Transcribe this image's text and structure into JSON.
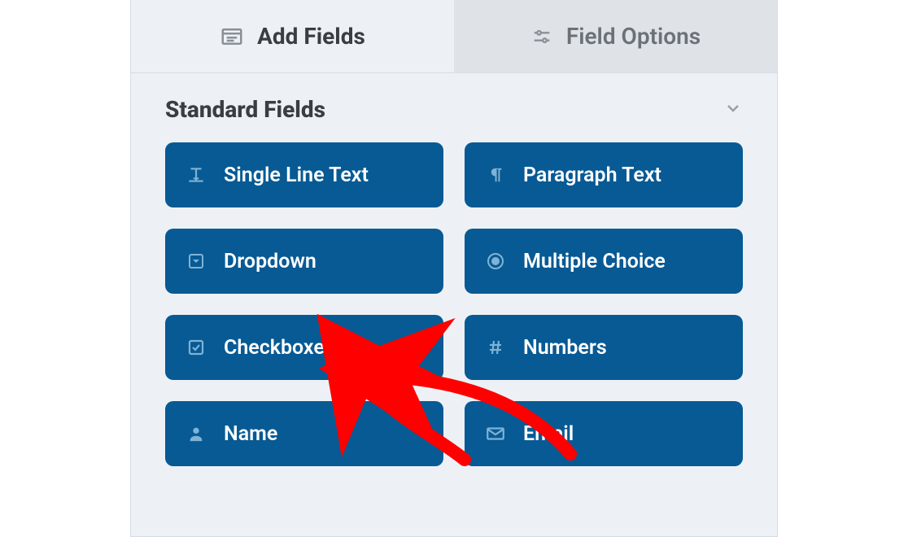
{
  "tabs": {
    "add_fields": {
      "label": "Add Fields"
    },
    "field_options": {
      "label": "Field Options"
    }
  },
  "section": {
    "title": "Standard Fields"
  },
  "fields": {
    "single_line_text": {
      "label": "Single Line Text"
    },
    "paragraph_text": {
      "label": "Paragraph Text"
    },
    "dropdown": {
      "label": "Dropdown"
    },
    "multiple_choice": {
      "label": "Multiple Choice"
    },
    "checkboxes": {
      "label": "Checkboxes"
    },
    "numbers": {
      "label": "Numbers"
    },
    "name": {
      "label": "Name"
    },
    "email": {
      "label": "Email"
    }
  }
}
